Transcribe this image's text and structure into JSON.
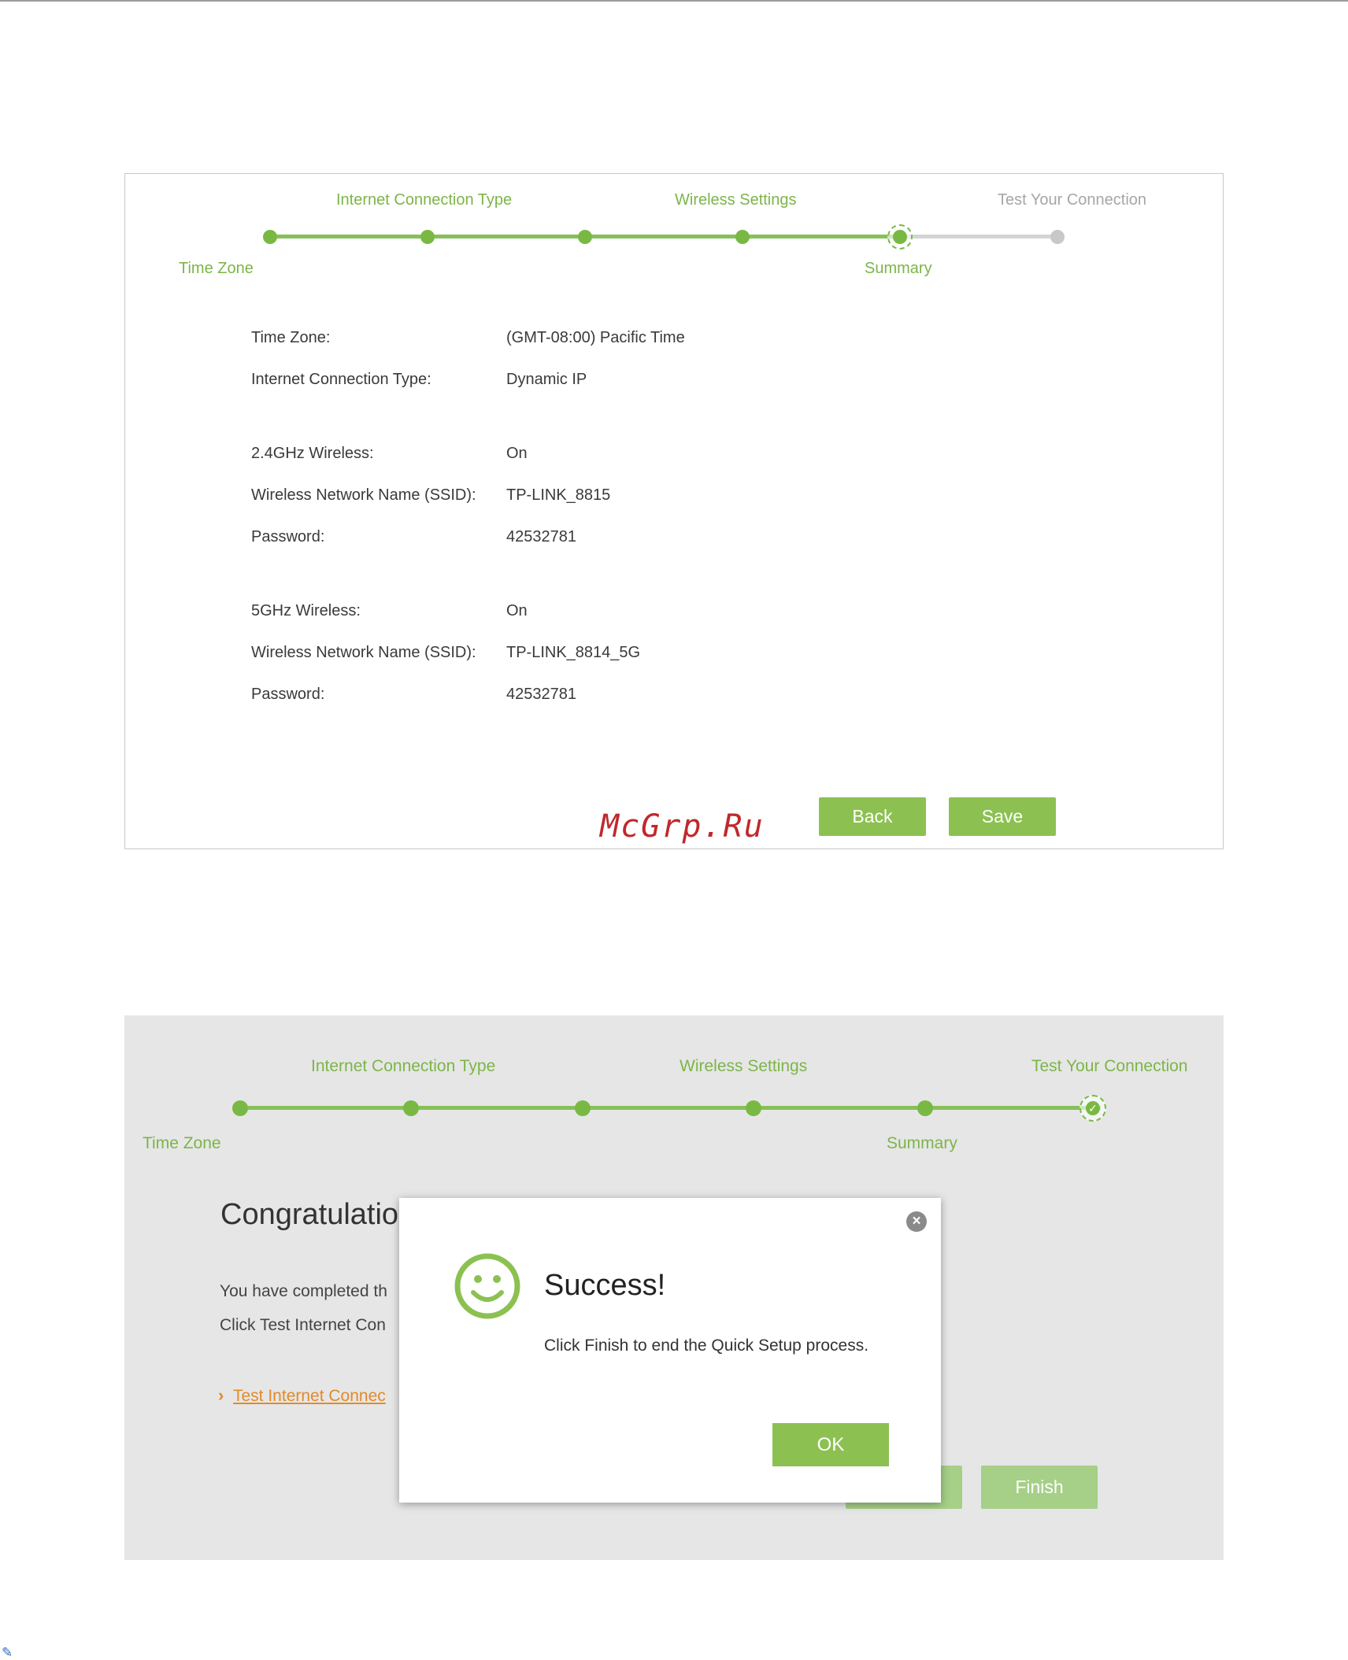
{
  "watermark": "McGrp.Ru",
  "summary_screen": {
    "steps": {
      "top_labels": [
        "Internet Connection Type",
        "Wireless Settings",
        "Test Your Connection"
      ],
      "bottom_labels": [
        "Time Zone",
        "Summary"
      ]
    },
    "rows": [
      {
        "label": "Time Zone:",
        "value": "(GMT-08:00) Pacific Time"
      },
      {
        "label": "Internet Connection Type:",
        "value": "Dynamic IP"
      },
      {
        "label": "2.4GHz Wireless:",
        "value": "On"
      },
      {
        "label": "Wireless Network Name (SSID):",
        "value": "TP-LINK_8815"
      },
      {
        "label": "Password:",
        "value": "42532781"
      },
      {
        "label": "5GHz Wireless:",
        "value": "On"
      },
      {
        "label": "Wireless Network Name (SSID):",
        "value": "TP-LINK_8814_5G"
      },
      {
        "label": "Password:",
        "value": "42532781"
      }
    ],
    "buttons": {
      "back": "Back",
      "save": "Save"
    }
  },
  "finish_screen": {
    "steps": {
      "top_labels": [
        "Internet Connection Type",
        "Wireless Settings",
        "Test Your Connection"
      ],
      "bottom_labels": [
        "Time Zone",
        "Summary"
      ]
    },
    "heading": "Congratulatio",
    "line1": "You have completed th",
    "line2": "Click Test Internet Con",
    "link": "Test Internet Connec",
    "buttons": {
      "finish": "Finish"
    }
  },
  "dialog": {
    "title": "Success!",
    "message": "Click Finish to end the Quick Setup process.",
    "ok_label": "OK",
    "close_icon": "close-icon",
    "status_icon": "smiley-icon"
  },
  "colors": {
    "accent_green": "#8cc152",
    "step_inactive": "#a6a6a6",
    "link_orange": "#e28a2a",
    "watermark_red": "#c0282d"
  }
}
